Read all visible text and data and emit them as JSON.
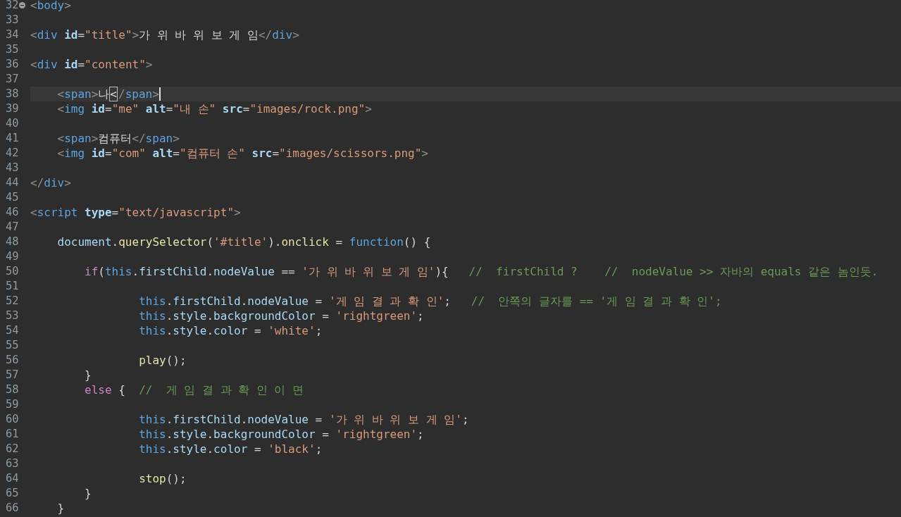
{
  "editor": {
    "lines": [
      {
        "number": "32",
        "selected": false,
        "expanded": true,
        "tokens": [
          {
            "kind": "bracket",
            "text": "<"
          },
          {
            "kind": "tag",
            "text": "body"
          },
          {
            "kind": "bracket",
            "text": ">"
          }
        ]
      },
      {
        "number": "33",
        "selected": false
      },
      {
        "number": "34",
        "selected": false,
        "tokens": [
          {
            "kind": "bracket",
            "text": "<"
          },
          {
            "kind": "tag",
            "text": "div"
          },
          {
            "kind": "attr",
            "text": " id"
          },
          {
            "kind": "op",
            "text": "="
          },
          {
            "kind": "string",
            "text": "\"title\""
          },
          {
            "kind": "bracket",
            "text": ">"
          },
          {
            "kind": "text",
            "text": "가 위 바 위 보 게 임"
          },
          {
            "kind": "bracket",
            "text": "</"
          },
          {
            "kind": "tag",
            "text": "div"
          },
          {
            "kind": "bracket",
            "text": ">"
          }
        ]
      },
      {
        "number": "35",
        "selected": false
      },
      {
        "number": "36",
        "selected": false,
        "tokens": [
          {
            "kind": "bracket",
            "text": "<"
          },
          {
            "kind": "tag",
            "text": "div"
          },
          {
            "kind": "attr",
            "text": " id"
          },
          {
            "kind": "op",
            "text": "="
          },
          {
            "kind": "string",
            "text": "\"content\""
          },
          {
            "kind": "bracket",
            "text": ">"
          }
        ]
      },
      {
        "number": "37",
        "selected": false
      },
      {
        "number": "38",
        "selected": true,
        "tokens": [
          {
            "kind": "bracket",
            "text": "    <"
          },
          {
            "kind": "tag",
            "text": "span"
          },
          {
            "kind": "bracket",
            "text": ">"
          },
          {
            "kind": "text",
            "text": "나"
          },
          {
            "kind": "match",
            "text": "<"
          },
          {
            "kind": "bracket",
            "text": "/"
          },
          {
            "kind": "tag",
            "text": "span"
          },
          {
            "kind": "bracket",
            "text": ">"
          }
        ]
      },
      {
        "number": "39",
        "selected": false,
        "tokens": [
          {
            "kind": "bracket",
            "text": "    <"
          },
          {
            "kind": "tag",
            "text": "img"
          },
          {
            "kind": "attr",
            "text": " id"
          },
          {
            "kind": "op",
            "text": "="
          },
          {
            "kind": "string",
            "text": "\"me\""
          },
          {
            "kind": "attr",
            "text": " alt"
          },
          {
            "kind": "op",
            "text": "="
          },
          {
            "kind": "string",
            "text": "\"내 손\""
          },
          {
            "kind": "attr",
            "text": " src"
          },
          {
            "kind": "op",
            "text": "="
          },
          {
            "kind": "string",
            "text": "\"images/rock.png\""
          },
          {
            "kind": "bracket",
            "text": ">"
          }
        ]
      },
      {
        "number": "40",
        "selected": false
      },
      {
        "number": "41",
        "selected": false,
        "tokens": [
          {
            "kind": "bracket",
            "text": "    <"
          },
          {
            "kind": "tag",
            "text": "span"
          },
          {
            "kind": "bracket",
            "text": ">"
          },
          {
            "kind": "text",
            "text": "컴퓨터"
          },
          {
            "kind": "bracket",
            "text": "</"
          },
          {
            "kind": "tag",
            "text": "span"
          },
          {
            "kind": "bracket",
            "text": ">"
          }
        ]
      },
      {
        "number": "42",
        "selected": false,
        "tokens": [
          {
            "kind": "bracket",
            "text": "    <"
          },
          {
            "kind": "tag",
            "text": "img"
          },
          {
            "kind": "attr",
            "text": " id"
          },
          {
            "kind": "op",
            "text": "="
          },
          {
            "kind": "string",
            "text": "\"com\""
          },
          {
            "kind": "attr",
            "text": " alt"
          },
          {
            "kind": "op",
            "text": "="
          },
          {
            "kind": "string",
            "text": "\"컴퓨터 손\""
          },
          {
            "kind": "attr",
            "text": " src"
          },
          {
            "kind": "op",
            "text": "="
          },
          {
            "kind": "string",
            "text": "\"images/scissors.png\""
          },
          {
            "kind": "bracket",
            "text": ">"
          }
        ]
      },
      {
        "number": "43",
        "selected": false
      },
      {
        "number": "44",
        "selected": false,
        "tokens": [
          {
            "kind": "bracket",
            "text": "</"
          },
          {
            "kind": "tag",
            "text": "div"
          },
          {
            "kind": "bracket",
            "text": ">"
          }
        ]
      },
      {
        "number": "45",
        "selected": false
      },
      {
        "number": "46",
        "selected": false,
        "tokens": [
          {
            "kind": "bracket",
            "text": "<"
          },
          {
            "kind": "tag",
            "text": "script"
          },
          {
            "kind": "attr",
            "text": " type"
          },
          {
            "kind": "op",
            "text": "="
          },
          {
            "kind": "string",
            "text": "\"text/javascript\""
          },
          {
            "kind": "bracket",
            "text": ">"
          }
        ]
      },
      {
        "number": "47",
        "selected": false
      },
      {
        "number": "48",
        "selected": false,
        "tokens": [
          {
            "kind": "property",
            "text": "    document"
          },
          {
            "kind": "op",
            "text": "."
          },
          {
            "kind": "method",
            "text": "querySelector"
          },
          {
            "kind": "op",
            "text": "("
          },
          {
            "kind": "string",
            "text": "'#title'"
          },
          {
            "kind": "op",
            "text": ")."
          },
          {
            "kind": "method",
            "text": "onclick"
          },
          {
            "kind": "op",
            "text": " = "
          },
          {
            "kind": "keyword",
            "text": "function"
          },
          {
            "kind": "op",
            "text": "() {"
          }
        ]
      },
      {
        "number": "49",
        "selected": false
      },
      {
        "number": "50",
        "selected": false,
        "tokens": [
          {
            "kind": "control",
            "text": "        if"
          },
          {
            "kind": "op",
            "text": "("
          },
          {
            "kind": "keyword",
            "text": "this"
          },
          {
            "kind": "op",
            "text": "."
          },
          {
            "kind": "property",
            "text": "firstChild"
          },
          {
            "kind": "op",
            "text": "."
          },
          {
            "kind": "property",
            "text": "nodeValue"
          },
          {
            "kind": "op",
            "text": " == "
          },
          {
            "kind": "string",
            "text": "'가 위 바 위 보 게 임'"
          },
          {
            "kind": "op",
            "text": "){   "
          },
          {
            "kind": "comment",
            "text": "//  firstChild ?    //  nodeValue >> 자바의 equals 같은 놈인듯."
          }
        ]
      },
      {
        "number": "51",
        "selected": false
      },
      {
        "number": "52",
        "selected": false,
        "tokens": [
          {
            "kind": "keyword",
            "text": "                this"
          },
          {
            "kind": "op",
            "text": "."
          },
          {
            "kind": "property",
            "text": "firstChild"
          },
          {
            "kind": "op",
            "text": "."
          },
          {
            "kind": "property",
            "text": "nodeValue"
          },
          {
            "kind": "op",
            "text": " = "
          },
          {
            "kind": "string",
            "text": "'게 임 결 과 확 인'"
          },
          {
            "kind": "op",
            "text": ";   "
          },
          {
            "kind": "comment",
            "text": "//  안쪽의 글자를 == '게 임 결 과 확 인';"
          }
        ]
      },
      {
        "number": "53",
        "selected": false,
        "tokens": [
          {
            "kind": "keyword",
            "text": "                this"
          },
          {
            "kind": "op",
            "text": "."
          },
          {
            "kind": "property",
            "text": "style"
          },
          {
            "kind": "op",
            "text": "."
          },
          {
            "kind": "property",
            "text": "backgroundColor"
          },
          {
            "kind": "op",
            "text": " = "
          },
          {
            "kind": "string",
            "text": "'rightgreen'"
          },
          {
            "kind": "op",
            "text": ";"
          }
        ]
      },
      {
        "number": "54",
        "selected": false,
        "tokens": [
          {
            "kind": "keyword",
            "text": "                this"
          },
          {
            "kind": "op",
            "text": "."
          },
          {
            "kind": "property",
            "text": "style"
          },
          {
            "kind": "op",
            "text": "."
          },
          {
            "kind": "property",
            "text": "color"
          },
          {
            "kind": "op",
            "text": " = "
          },
          {
            "kind": "string",
            "text": "'white'"
          },
          {
            "kind": "op",
            "text": ";"
          }
        ]
      },
      {
        "number": "55",
        "selected": false
      },
      {
        "number": "56",
        "selected": false,
        "tokens": [
          {
            "kind": "method",
            "text": "                play"
          },
          {
            "kind": "op",
            "text": "();"
          }
        ]
      },
      {
        "number": "57",
        "selected": false,
        "tokens": [
          {
            "kind": "op",
            "text": "        }"
          }
        ]
      },
      {
        "number": "58",
        "selected": false,
        "tokens": [
          {
            "kind": "control",
            "text": "        else"
          },
          {
            "kind": "op",
            "text": " {  "
          },
          {
            "kind": "comment",
            "text": "//  게 임 결 과 확 인 이 면"
          }
        ]
      },
      {
        "number": "59",
        "selected": false
      },
      {
        "number": "60",
        "selected": false,
        "tokens": [
          {
            "kind": "keyword",
            "text": "                this"
          },
          {
            "kind": "op",
            "text": "."
          },
          {
            "kind": "property",
            "text": "firstChild"
          },
          {
            "kind": "op",
            "text": "."
          },
          {
            "kind": "property",
            "text": "nodeValue"
          },
          {
            "kind": "op",
            "text": " = "
          },
          {
            "kind": "string",
            "text": "'가 위 바 위 보 게 임'"
          },
          {
            "kind": "op",
            "text": ";"
          }
        ]
      },
      {
        "number": "61",
        "selected": false,
        "tokens": [
          {
            "kind": "keyword",
            "text": "                this"
          },
          {
            "kind": "op",
            "text": "."
          },
          {
            "kind": "property",
            "text": "style"
          },
          {
            "kind": "op",
            "text": "."
          },
          {
            "kind": "property",
            "text": "backgroundColor"
          },
          {
            "kind": "op",
            "text": " = "
          },
          {
            "kind": "string",
            "text": "'rightgreen'"
          },
          {
            "kind": "op",
            "text": ";"
          }
        ]
      },
      {
        "number": "62",
        "selected": false,
        "tokens": [
          {
            "kind": "keyword",
            "text": "                this"
          },
          {
            "kind": "op",
            "text": "."
          },
          {
            "kind": "property",
            "text": "style"
          },
          {
            "kind": "op",
            "text": "."
          },
          {
            "kind": "property",
            "text": "color"
          },
          {
            "kind": "op",
            "text": " = "
          },
          {
            "kind": "string",
            "text": "'black'"
          },
          {
            "kind": "op",
            "text": ";"
          }
        ]
      },
      {
        "number": "63",
        "selected": false
      },
      {
        "number": "64",
        "selected": false,
        "tokens": [
          {
            "kind": "method",
            "text": "                stop"
          },
          {
            "kind": "op",
            "text": "();"
          }
        ]
      },
      {
        "number": "65",
        "selected": false,
        "tokens": [
          {
            "kind": "op",
            "text": "        }"
          }
        ]
      },
      {
        "number": "66",
        "selected": false,
        "tokens": [
          {
            "kind": "op",
            "text": "    }"
          }
        ]
      }
    ]
  }
}
